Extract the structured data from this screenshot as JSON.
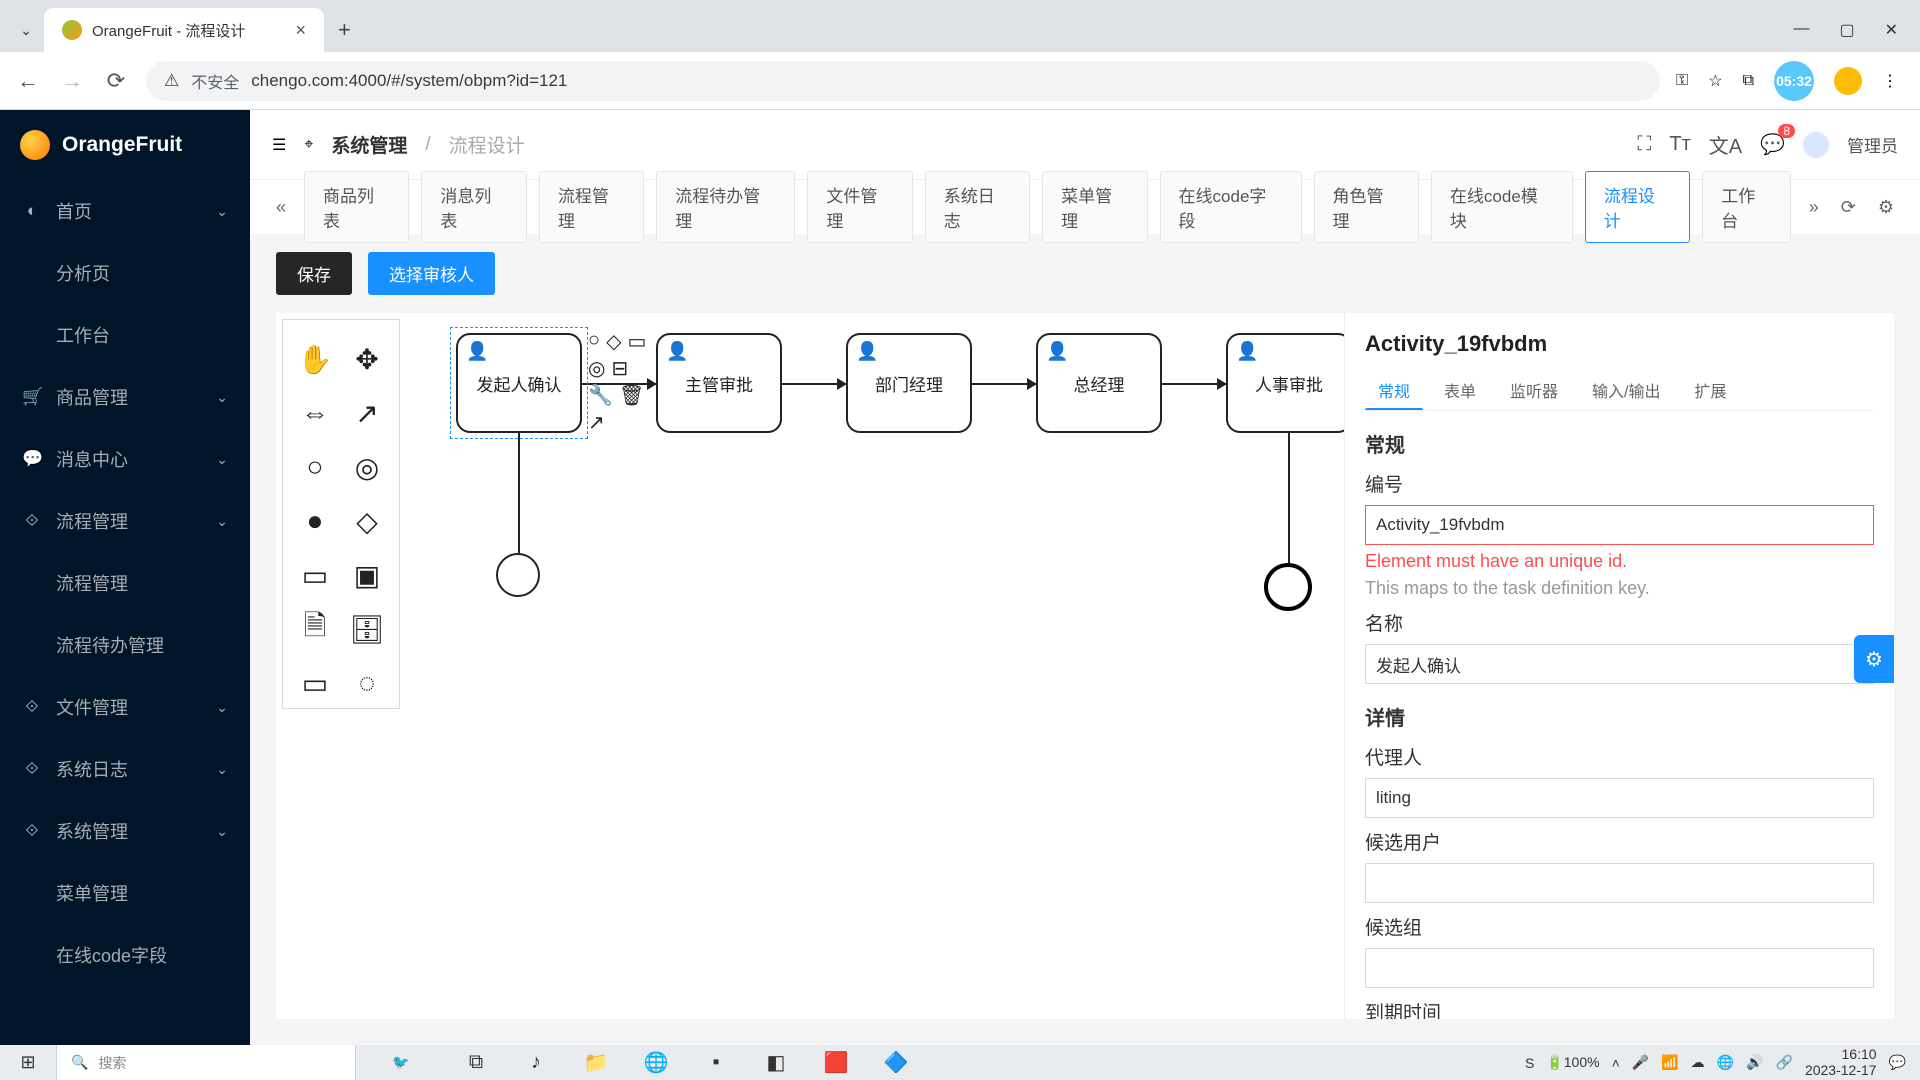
{
  "browser": {
    "tab_title": "OrangeFruit - 流程设计",
    "insecure": "不安全",
    "url": "chengo.com:4000/#/system/obpm?id=121",
    "ext_time": "05:32"
  },
  "app": {
    "brand": "OrangeFruit",
    "user_name": "管理员",
    "msg_badge": "8"
  },
  "sidebar": {
    "items": [
      {
        "icon": "◐",
        "label": "首页",
        "chev": "⌄",
        "sub": false
      },
      {
        "icon": "",
        "label": "分析页",
        "chev": "",
        "sub": true
      },
      {
        "icon": "",
        "label": "工作台",
        "chev": "",
        "sub": true
      },
      {
        "icon": "🛒",
        "label": "商品管理",
        "chev": "⌄",
        "sub": false
      },
      {
        "icon": "💬",
        "label": "消息中心",
        "chev": "⌄",
        "sub": false
      },
      {
        "icon": "⟐",
        "label": "流程管理",
        "chev": "⌄",
        "sub": false
      },
      {
        "icon": "",
        "label": "流程管理",
        "chev": "",
        "sub": true
      },
      {
        "icon": "",
        "label": "流程待办管理",
        "chev": "",
        "sub": true
      },
      {
        "icon": "⟐",
        "label": "文件管理",
        "chev": "⌄",
        "sub": false
      },
      {
        "icon": "⟐",
        "label": "系统日志",
        "chev": "⌄",
        "sub": false
      },
      {
        "icon": "⟐",
        "label": "系统管理",
        "chev": "⌄",
        "sub": false
      },
      {
        "icon": "",
        "label": "菜单管理",
        "chev": "",
        "sub": true
      },
      {
        "icon": "",
        "label": "在线code字段",
        "chev": "",
        "sub": true
      }
    ]
  },
  "breadcrumb": {
    "a": "系统管理",
    "b": "流程设计"
  },
  "tabs": [
    "商品列表",
    "消息列表",
    "流程管理",
    "流程待办管理",
    "文件管理",
    "系统日志",
    "菜单管理",
    "在线code字段",
    "角色管理",
    "在线code模块",
    "流程设计",
    "工作台"
  ],
  "active_tab_index": 10,
  "buttons": {
    "save": "保存",
    "select_approver": "选择审核人"
  },
  "bpmn": {
    "nodes": [
      "发起人确认",
      "主管审批",
      "部门经理",
      "总经理",
      "人事审批"
    ]
  },
  "panel": {
    "title": "Activity_19fvbdm",
    "tabs": [
      "常规",
      "表单",
      "监听器",
      "输入/输出",
      "扩展"
    ],
    "section_general": "常规",
    "id_label": "编号",
    "id_value": "Activity_19fvbdm",
    "id_error": "Element must have an unique id.",
    "id_hint": "This maps to the task definition key.",
    "name_label": "名称",
    "name_value": "发起人确认",
    "detail_label": "详情",
    "assignee_label": "代理人",
    "assignee_value": "liting",
    "cand_user_label": "候选用户",
    "cand_user_value": "",
    "cand_group_label": "候选组",
    "cand_group_value": "",
    "due_label": "到期时间"
  },
  "taskbar": {
    "search_placeholder": "搜索",
    "battery": "100%",
    "time": "16:10",
    "date": "2023-12-17"
  }
}
